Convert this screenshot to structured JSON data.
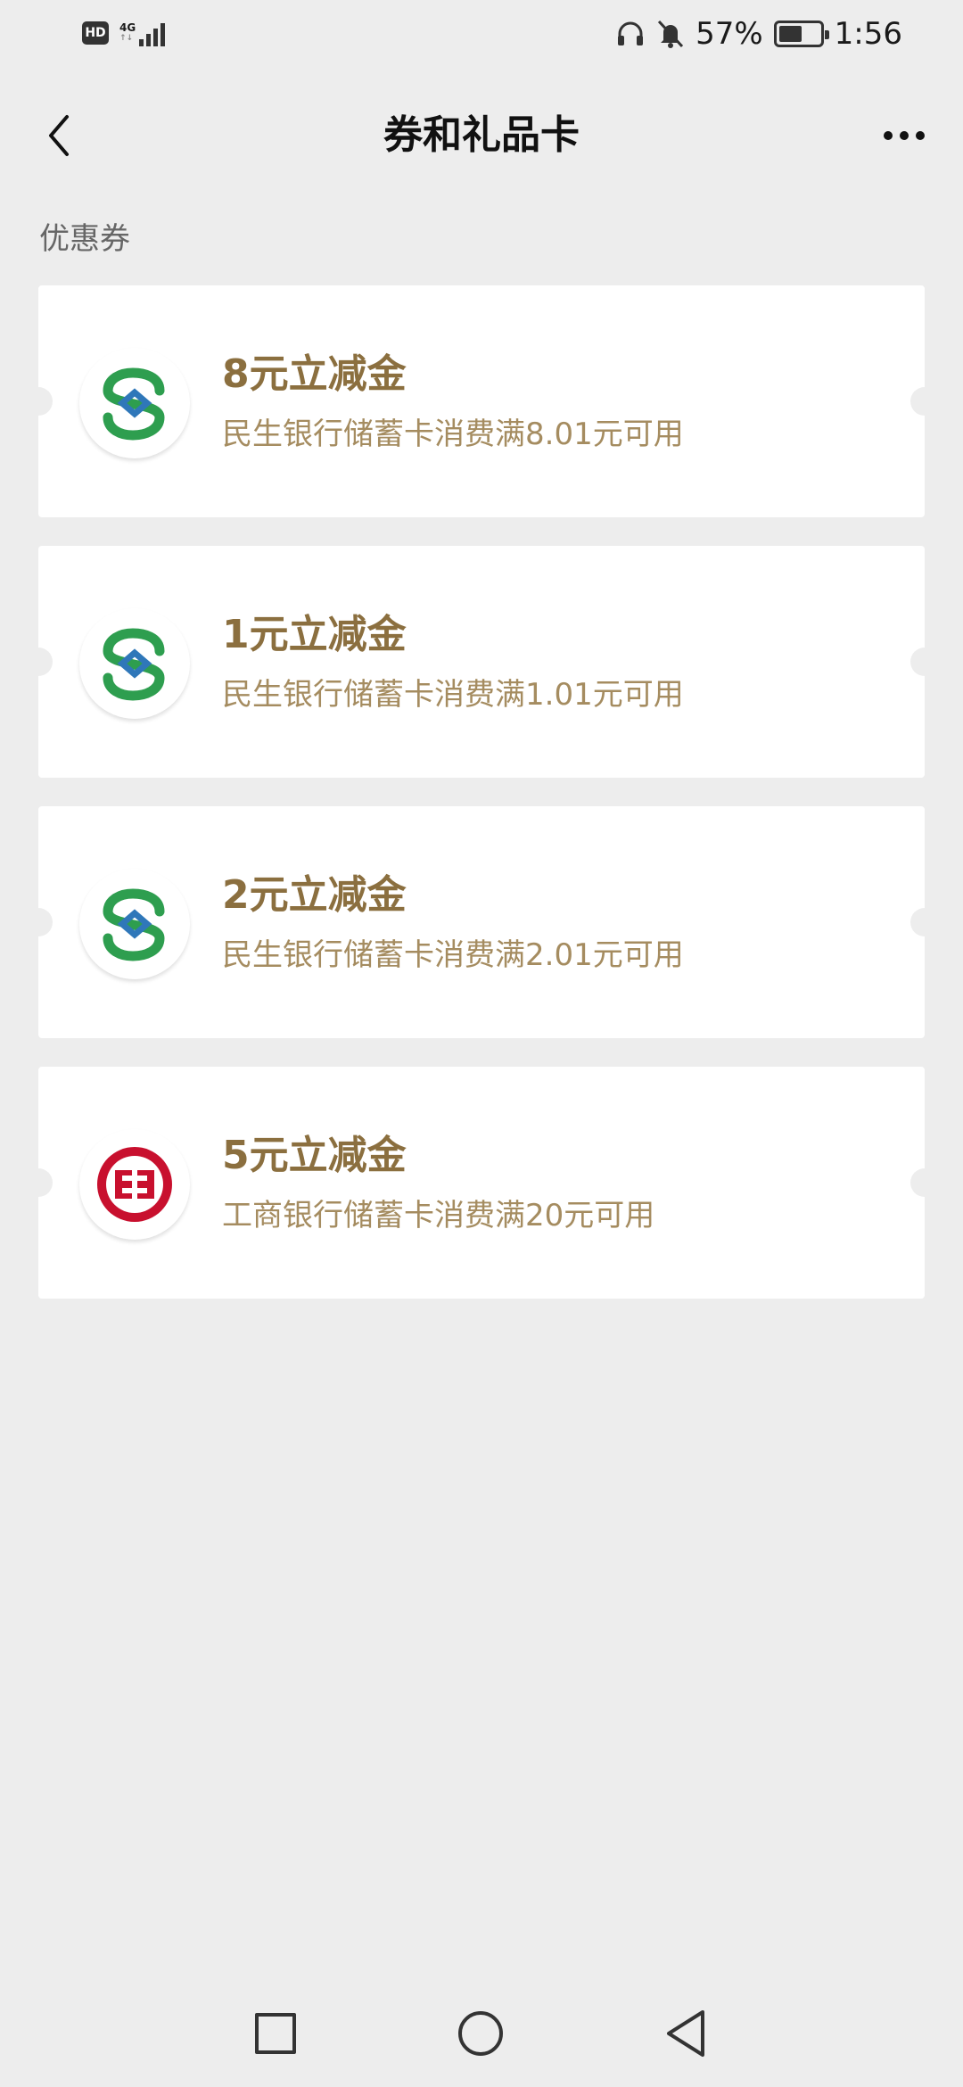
{
  "status_bar": {
    "hd": "HD",
    "network": "4G",
    "network_sub": "↑↓",
    "battery": "57%",
    "time": "1:56"
  },
  "nav": {
    "title": "券和礼品卡"
  },
  "section": {
    "label": "优惠券"
  },
  "coupons": [
    {
      "title": "8元立减金",
      "desc": "民生银行储蓄卡消费满8.01元可用",
      "bank_icon": "cmbc-bank-logo"
    },
    {
      "title": "1元立减金",
      "desc": "民生银行储蓄卡消费满1.01元可用",
      "bank_icon": "cmbc-bank-logo"
    },
    {
      "title": "2元立减金",
      "desc": "民生银行储蓄卡消费满2.01元可用",
      "bank_icon": "cmbc-bank-logo"
    },
    {
      "title": "5元立减金",
      "desc": "工商银行储蓄卡消费满20元可用",
      "bank_icon": "icbc-bank-logo"
    }
  ],
  "colors": {
    "background": "#ededed",
    "coupon_title": "#8b6f3f",
    "coupon_desc": "#a58c60",
    "cmbc_green": "#2e9e4f",
    "cmbc_blue": "#2f77b9",
    "icbc_red": "#c8102e"
  }
}
